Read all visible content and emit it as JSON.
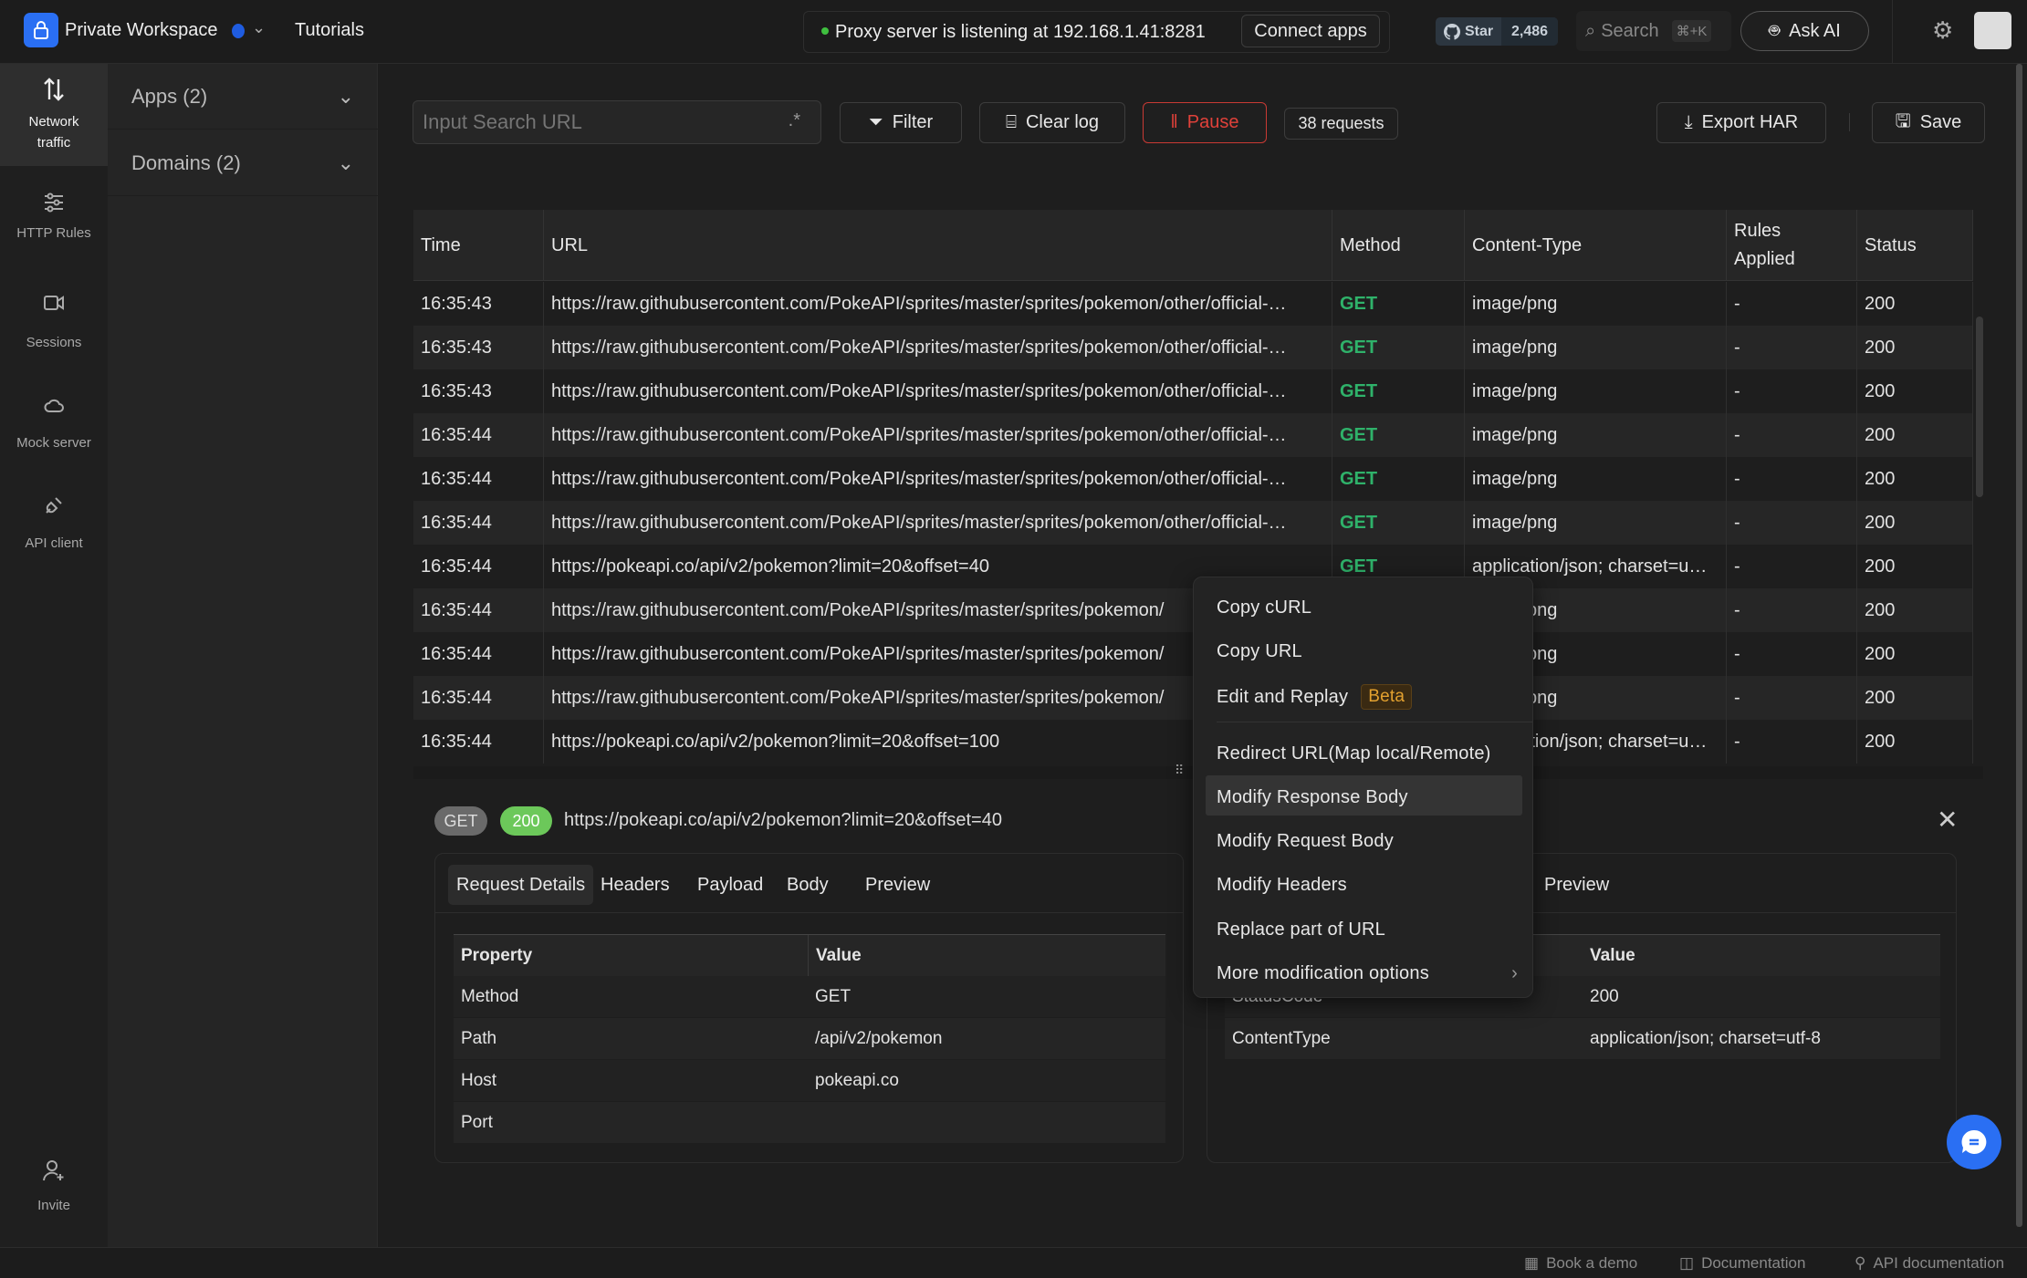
{
  "topbar": {
    "workspace": "Private Workspace",
    "tutorials": "Tutorials",
    "proxy_status": "Proxy server is listening at 192.168.1.41:8281",
    "connect_apps": "Connect apps",
    "github_star": "Star",
    "github_count": "2,486",
    "search": "Search",
    "search_shortcut": "⌘+K",
    "ask_ai": "Ask AI"
  },
  "rail": {
    "items": [
      {
        "label1": "Network",
        "label2": "traffic",
        "icon": "arrows-up-down-icon",
        "active": true
      },
      {
        "label1": "HTTP Rules",
        "icon": "sliders-icon"
      },
      {
        "label1": "Sessions",
        "icon": "video-icon"
      },
      {
        "label1": "Mock server",
        "icon": "cloud-icon"
      },
      {
        "label1": "API client",
        "icon": "plug-icon"
      }
    ],
    "invite": "Invite"
  },
  "side": {
    "apps": "Apps (2)",
    "domains": "Domains (2)"
  },
  "toolbar": {
    "search_placeholder": "Input Search URL",
    "regex": ".*",
    "filter": "Filter",
    "clear_log": "Clear log",
    "pause": "Pause",
    "requests": "38 requests",
    "export_har": "Export HAR",
    "save": "Save"
  },
  "table": {
    "headers": [
      "Time",
      "URL",
      "Method",
      "Content-Type",
      "Rules Applied",
      "Status"
    ],
    "rows": [
      [
        "16:35:43",
        "https://raw.githubusercontent.com/PokeAPI/sprites/master/sprites/pokemon/other/official-…",
        "GET",
        "image/png",
        "-",
        "200"
      ],
      [
        "16:35:43",
        "https://raw.githubusercontent.com/PokeAPI/sprites/master/sprites/pokemon/other/official-…",
        "GET",
        "image/png",
        "-",
        "200"
      ],
      [
        "16:35:43",
        "https://raw.githubusercontent.com/PokeAPI/sprites/master/sprites/pokemon/other/official-…",
        "GET",
        "image/png",
        "-",
        "200"
      ],
      [
        "16:35:44",
        "https://raw.githubusercontent.com/PokeAPI/sprites/master/sprites/pokemon/other/official-…",
        "GET",
        "image/png",
        "-",
        "200"
      ],
      [
        "16:35:44",
        "https://raw.githubusercontent.com/PokeAPI/sprites/master/sprites/pokemon/other/official-…",
        "GET",
        "image/png",
        "-",
        "200"
      ],
      [
        "16:35:44",
        "https://raw.githubusercontent.com/PokeAPI/sprites/master/sprites/pokemon/other/official-…",
        "GET",
        "image/png",
        "-",
        "200"
      ],
      [
        "16:35:44",
        "https://pokeapi.co/api/v2/pokemon?limit=20&offset=40",
        "GET",
        "application/json; charset=u…",
        "-",
        "200"
      ],
      [
        "16:35:44",
        "https://raw.githubusercontent.com/PokeAPI/sprites/master/sprites/pokemon/",
        "",
        "image/png",
        "-",
        "200"
      ],
      [
        "16:35:44",
        "https://raw.githubusercontent.com/PokeAPI/sprites/master/sprites/pokemon/",
        "",
        "image/png",
        "-",
        "200"
      ],
      [
        "16:35:44",
        "https://raw.githubusercontent.com/PokeAPI/sprites/master/sprites/pokemon/",
        "",
        "image/png",
        "-",
        "200"
      ],
      [
        "16:35:44",
        "https://pokeapi.co/api/v2/pokemon?limit=20&offset=100",
        "",
        "application/json; charset=u…",
        "-",
        "200"
      ]
    ]
  },
  "detail": {
    "method": "GET",
    "status": "200",
    "url": "https://pokeapi.co/api/v2/pokemon?limit=20&offset=40",
    "request_tabs": [
      "Request Details",
      "Headers",
      "Payload",
      "Body",
      "Preview"
    ],
    "request_table": {
      "headers": [
        "Property",
        "Value"
      ],
      "rows": [
        [
          "Method",
          "GET"
        ],
        [
          "Path",
          "/api/v2/pokemon"
        ],
        [
          "Host",
          "pokeapi.co"
        ],
        [
          "Port",
          ""
        ]
      ]
    },
    "response_tabs": [
      "Preview"
    ],
    "response_table": {
      "value_header": "Value",
      "rows": [
        [
          "StatusCode",
          "200"
        ],
        [
          "ContentType",
          "application/json; charset=utf-8"
        ]
      ]
    }
  },
  "context_menu": {
    "items": [
      "Copy cURL",
      "Copy URL",
      "Edit and Replay",
      "Redirect URL(Map local/Remote)",
      "Modify Response Body",
      "Modify Request Body",
      "Modify Headers",
      "Replace part of URL",
      "More modification options"
    ],
    "beta": "Beta",
    "highlighted": "Modify Response Body"
  },
  "footer": {
    "book_demo": "Book a demo",
    "documentation": "Documentation",
    "api_docs": "API documentation"
  },
  "colors": {
    "accent": "#2a6ff3",
    "get": "#2fb26a",
    "pause": "#e0413a",
    "status_ok": "#6cc85a",
    "beta": "#e3a12f"
  }
}
